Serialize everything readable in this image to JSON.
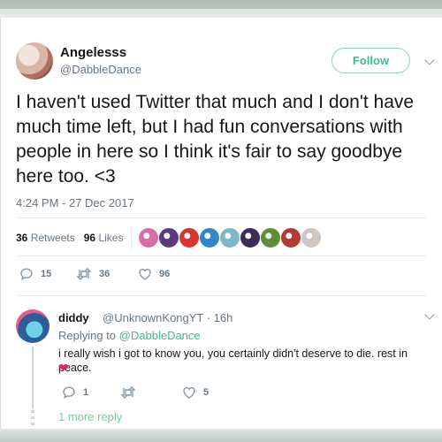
{
  "tweet": {
    "author_name": "Angelesss",
    "author_handle": "@DabbleDance",
    "follow_label": "Follow",
    "text": "I haven't used Twitter that much and I don't have much time left, but I had fun conversations with people in here so I think it's fair to say goodbye here too. <3",
    "timestamp": "4:24 PM - 27 Dec 2017",
    "retweets_count": "36",
    "retweets_label": "Retweets",
    "likes_count": "96",
    "likes_label": "Likes",
    "actions": {
      "replies": "15",
      "retweets": "36",
      "likes": "96"
    },
    "likers": [
      {
        "icon": "liker-avatar",
        "color": "#d66fa8"
      },
      {
        "icon": "liker-avatar",
        "color": "#5b3a7a"
      },
      {
        "icon": "liker-avatar",
        "color": "#d8352f"
      },
      {
        "icon": "liker-avatar",
        "color": "#2f87c8"
      },
      {
        "icon": "liker-avatar",
        "color": "#7fb6c9"
      },
      {
        "icon": "liker-avatar",
        "color": "#3e2b56"
      },
      {
        "icon": "liker-avatar",
        "color": "#5c8f3a"
      },
      {
        "icon": "liker-avatar",
        "color": "#b03a34"
      },
      {
        "icon": "liker-avatar",
        "color": "#cfc6c0"
      }
    ]
  },
  "reply": {
    "author_name": "diddy",
    "meta": "@UnknownKongYT · 16h",
    "replying_prefix": "Replying to",
    "replying_mention": "@DabbleDance",
    "text": "i really wish i got to know you, you certainly didn't deserve to die. rest in peace.",
    "emoji": "❤",
    "actions": {
      "replies": "1",
      "retweets": "",
      "likes": "5"
    }
  },
  "more_replies_label": "1 more reply",
  "colors": {
    "accent": "#45b98a",
    "text_primary": "#14171a",
    "text_secondary": "#657786",
    "heart": "#e0245e"
  }
}
